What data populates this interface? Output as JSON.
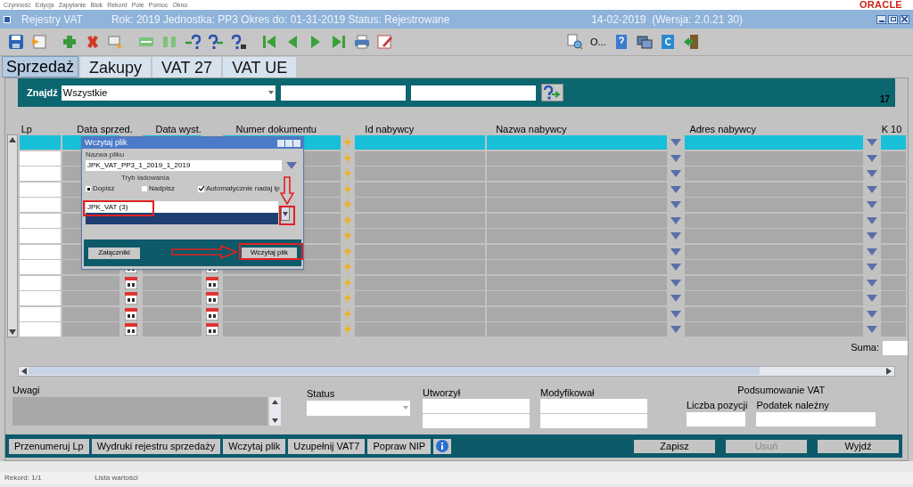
{
  "menu": [
    "Czynność",
    "Edycja",
    "Zapytanie",
    "Blok",
    "Rekord",
    "Pole",
    "Pomoc",
    "Okno"
  ],
  "logo": "ORACLE",
  "window": {
    "title": "Rejestry VAT",
    "info": "Rok: 2019 Jednostka: PP3 Okres do: 01-31-2019 Status: Rejestrowane",
    "date": "14-02-2019  (Wersja: 2.0.21 30)"
  },
  "toolbar": {
    "text_button": "O..."
  },
  "tabs": [
    {
      "label": "Sprzedaż",
      "selected": true
    },
    {
      "label": "Zakupy",
      "selected": false
    },
    {
      "label": "VAT 27",
      "selected": false
    },
    {
      "label": "VAT UE",
      "selected": false
    }
  ],
  "search": {
    "label": "Znajdź",
    "value": "Wszystkie",
    "count": "17"
  },
  "grid": {
    "columns": [
      "Lp",
      "Data sprzed.",
      "Data wyst.",
      "Numer dokumentu",
      "Id nabywcy",
      "Nazwa nabywcy",
      "Adres nabywcy",
      "K 10"
    ],
    "rows": [
      {
        "selected": true
      },
      {
        "selected": false
      },
      {
        "selected": false
      },
      {
        "selected": false
      },
      {
        "selected": false
      },
      {
        "selected": false
      },
      {
        "selected": false
      },
      {
        "selected": false
      },
      {
        "selected": false
      },
      {
        "selected": false
      },
      {
        "selected": false
      },
      {
        "selected": false
      },
      {
        "selected": false
      }
    ],
    "sum_label": "Suma:"
  },
  "dialog": {
    "title": "Wczytaj plik",
    "file_label": "Nazwa pliku",
    "file_value": "JPK_VAT_PP3_1_2019_1_2019",
    "mode_label": "Tryb ładowania",
    "modes": [
      {
        "label": "Dopisz",
        "selected": true
      },
      {
        "label": "Nadpisz",
        "selected": false
      }
    ],
    "auto": {
      "label": "Automatycznie nadaj lp",
      "checked": true
    },
    "list": [
      {
        "label": "JPK_VAT (3)",
        "selected": false
      },
      {
        "selected": true
      }
    ],
    "buttons": [
      "Załączniki",
      "Wczytaj plik"
    ]
  },
  "form": {
    "notes_label": "Uwagi",
    "status_label": "Status",
    "created_label": "Utworzył",
    "modified_label": "Modyfikował",
    "summary_title": "Podsumowanie VAT",
    "count_label": "Liczba pozycji",
    "tax_label": "Podatek należny"
  },
  "actions": [
    "Przenumeruj Lp",
    "Wydruki rejestru sprzedaży",
    "Wczytaj plik",
    "Uzupełnij VAT7",
    "Popraw NIP"
  ],
  "main_buttons": [
    {
      "label": "Zapisz",
      "disabled": false
    },
    {
      "label": "Usuń",
      "disabled": true
    },
    {
      "label": "Wyjdź",
      "disabled": false
    }
  ],
  "status_bar": [
    "Rekord: 1/1",
    "Lista wartości"
  ]
}
